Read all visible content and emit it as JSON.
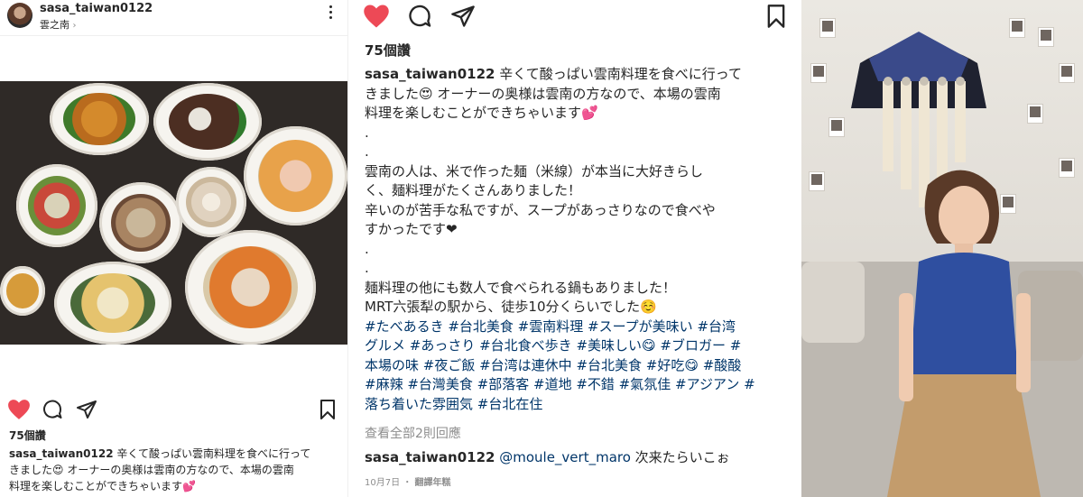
{
  "left": {
    "username": "sasa_taiwan0122",
    "location": "雲之南",
    "likes": "75個讚",
    "caption_user": "sasa_taiwan0122",
    "caption_lines": [
      " 辛くて酸っぱい雲南料理を食べに行って",
      "きました😍 オーナーの奥様は雲南の方なので、本場の雲南",
      "料理を楽しむことができちゃいます💕"
    ]
  },
  "middle": {
    "likes": "75個讚",
    "caption_user": "sasa_taiwan0122",
    "caption_lines": [
      " 辛くて酸っぱい雲南料理を食べに行って",
      "きました😍 オーナーの奥様は雲南の方なので、本場の雲南",
      "料理を楽しむことができちゃいます💕",
      ".",
      ".",
      "雲南の人は、米で作った麺（米線）が本当に大好きらし",
      "く、麺料理がたくさんありました！",
      "辛いのが苦手な私ですが、スープがあっさりなので食べや",
      "すかったです❤",
      ".",
      ".",
      "麺料理の他にも数人で食べられる鍋もありました！",
      "MRT六張犁の駅から、徒歩10分くらいでした☺️"
    ],
    "hashtag_lines": [
      "#たべあるき #台北美食 #雲南料理 #スープが美味い #台湾",
      "グルメ #あっさり #台北食べ歩き #美味しい😋 #ブロガー #",
      "本場の味 #夜ご飯 #台湾は連休中 #台北美食 #好吃😋 #酸酸",
      "#麻辣 #台灣美食 #部落客 #道地 #不錯 #氣氛佳 #アジアン #",
      "落ち着いた雰囲気 #台北在住"
    ],
    "view_all": "查看全部2則回應",
    "comment_user": "sasa_taiwan0122",
    "comment_mention": "@moule_vert_maro",
    "comment_text": " 次来たらいこぉ",
    "timestamp": "10月7日",
    "translate": "翻譯年糕"
  },
  "colors": {
    "heart": "#ed4956",
    "text": "#262626",
    "muted": "#8e8e8e",
    "link": "#003569"
  },
  "icons": [
    "heart-icon",
    "comment-icon",
    "share-icon",
    "bookmark-icon",
    "more-options-icon",
    "chevron-right-icon"
  ]
}
